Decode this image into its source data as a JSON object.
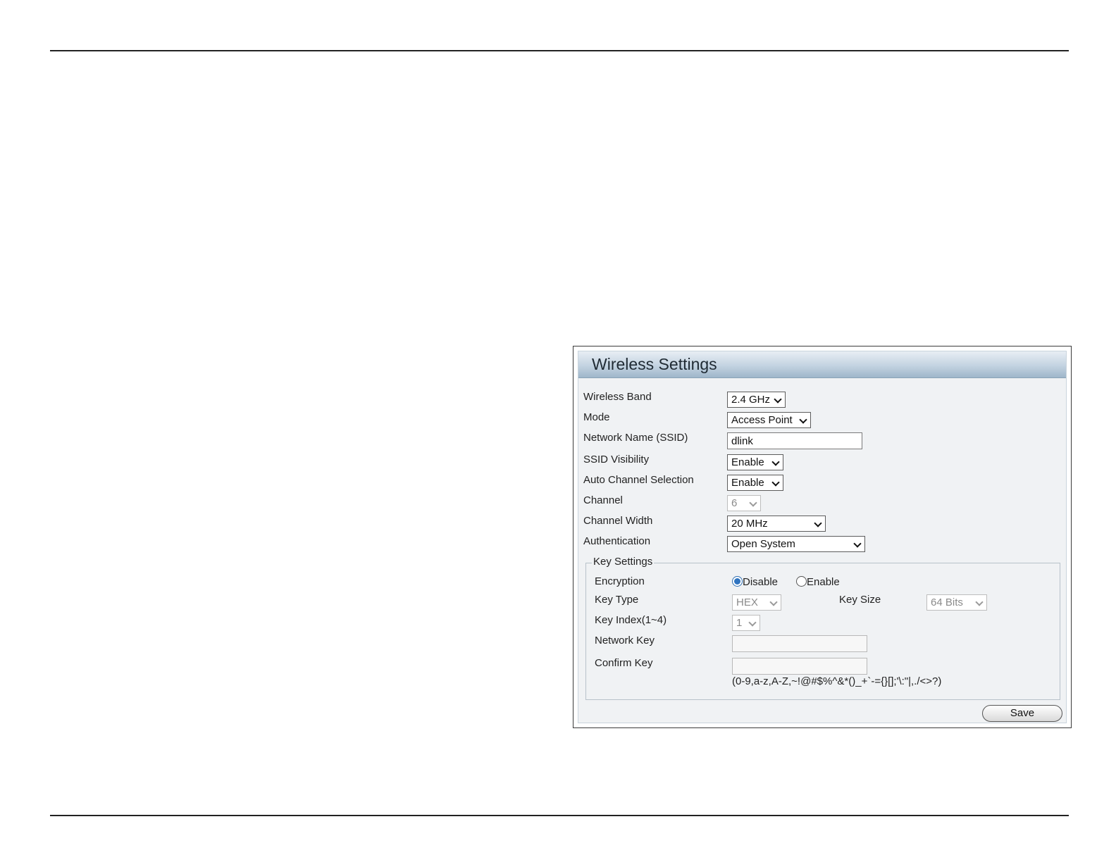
{
  "panel": {
    "title": "Wireless Settings",
    "fields": {
      "wireless_band": {
        "label": "Wireless Band",
        "value": "2.4 GHz"
      },
      "mode": {
        "label": "Mode",
        "value": "Access Point"
      },
      "ssid": {
        "label": "Network Name (SSID)",
        "value": "dlink"
      },
      "ssid_visibility": {
        "label": "SSID Visibility",
        "value": "Enable"
      },
      "auto_channel": {
        "label": "Auto Channel Selection",
        "value": "Enable"
      },
      "channel": {
        "label": "Channel",
        "value": "6"
      },
      "channel_width": {
        "label": "Channel Width",
        "value": "20 MHz"
      },
      "authentication": {
        "label": "Authentication",
        "value": "Open System"
      }
    },
    "key_settings": {
      "legend": "Key Settings",
      "encryption": {
        "label": "Encryption",
        "options": [
          "Disable",
          "Enable"
        ],
        "selected": "Disable"
      },
      "key_type": {
        "label": "Key Type",
        "value": "HEX"
      },
      "key_size": {
        "label": "Key Size",
        "value": "64 Bits"
      },
      "key_index": {
        "label": "Key Index(1~4)",
        "value": "1"
      },
      "network_key": {
        "label": "Network Key",
        "value": ""
      },
      "confirm_key": {
        "label": "Confirm Key",
        "value": ""
      },
      "allowed_chars": "(0-9,a-z,A-Z,~!@#$%^&*()_+`-={}[];'\\:\"|,./<>?)"
    },
    "save_label": "Save"
  }
}
